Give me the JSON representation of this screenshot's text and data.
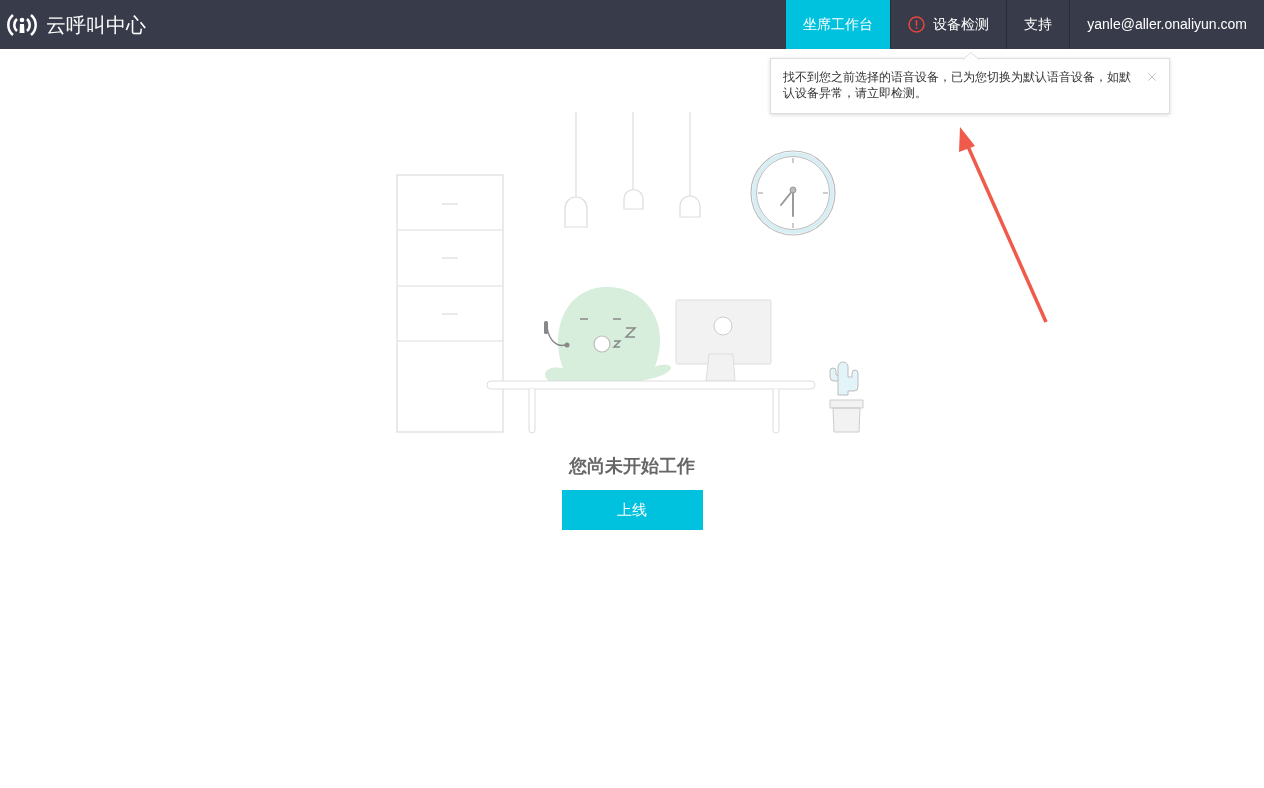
{
  "header": {
    "logo_text": "云呼叫中心",
    "nav": [
      {
        "label": "坐席工作台",
        "selected": true,
        "warning": false
      },
      {
        "label": "设备检测",
        "selected": false,
        "warning": true
      },
      {
        "label": "支持",
        "selected": false,
        "warning": false
      },
      {
        "label": "yanle@aller.onaliyun.com",
        "selected": false,
        "warning": false
      }
    ]
  },
  "notification": {
    "message": "找不到您之前选择的语音设备，已为您切换为默认语音设备，如默认设备异常，请立即检测。"
  },
  "main": {
    "status_text": "您尚未开始工作",
    "online_button": "上线"
  }
}
